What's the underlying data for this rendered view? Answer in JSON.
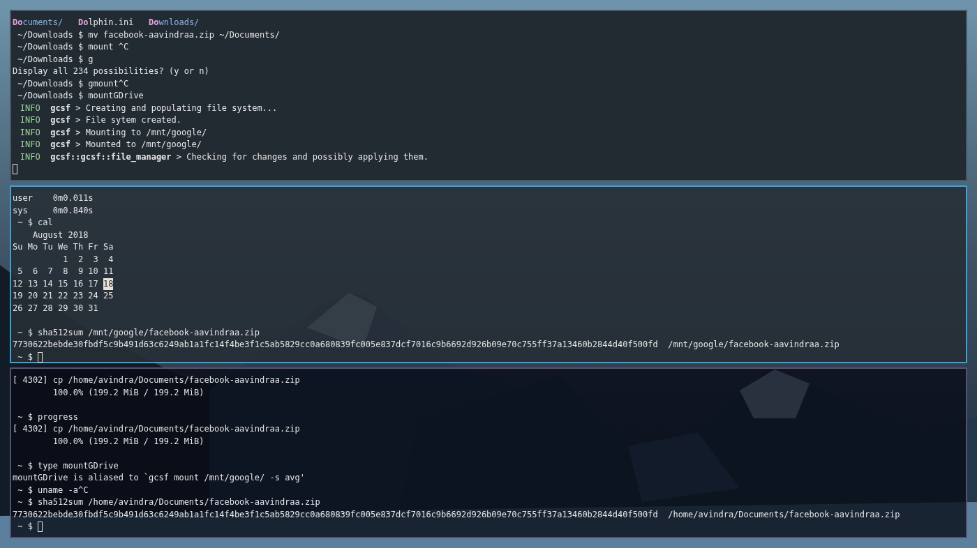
{
  "panes": [
    {
      "selected": false,
      "lines": [
        {
          "kind": "ls",
          "entries": [
            {
              "match": "Do",
              "rest": "cuments/",
              "kind": "directory"
            },
            {
              "match": "Do",
              "rest": "lphin.ini",
              "kind": "file"
            },
            {
              "match": "Do",
              "rest": "wnloads/",
              "kind": "directory"
            }
          ]
        },
        {
          "kind": "prompt",
          "text": "~/Downloads $ mv facebook-aavindraa.zip ~/Documents/"
        },
        {
          "kind": "prompt",
          "text": "~/Downloads $ mount ^C"
        },
        {
          "kind": "prompt",
          "text": "~/Downloads $ g"
        },
        {
          "kind": "text",
          "text": "Display all 234 possibilities? (y or n)"
        },
        {
          "kind": "prompt",
          "text": "~/Downloads $ gmount^C"
        },
        {
          "kind": "prompt",
          "text": "~/Downloads $ mountGDrive"
        },
        {
          "kind": "log",
          "level": "INFO",
          "source": "gcsf",
          "message": "> Creating and populating file system..."
        },
        {
          "kind": "log",
          "level": "INFO",
          "source": "gcsf",
          "message": "> File sytem created."
        },
        {
          "kind": "log",
          "level": "INFO",
          "source": "gcsf",
          "message": "> Mounting to /mnt/google/"
        },
        {
          "kind": "log",
          "level": "INFO",
          "source": "gcsf",
          "message": "> Mounted to /mnt/google/"
        },
        {
          "kind": "log",
          "level": "INFO",
          "source": "gcsf::gcsf::file_manager",
          "message": "> Checking for changes and possibly applying them."
        },
        {
          "kind": "cursor"
        }
      ]
    },
    {
      "selected": true,
      "lines": [
        {
          "kind": "text",
          "text": "user    0m0.011s"
        },
        {
          "kind": "text",
          "text": "sys     0m0.840s"
        },
        {
          "kind": "prompt",
          "text": "~ $ cal"
        },
        {
          "kind": "text",
          "text": "    August 2018"
        },
        {
          "kind": "text",
          "text": "Su Mo Tu We Th Fr Sa"
        },
        {
          "kind": "text",
          "text": "          1  2  3  4"
        },
        {
          "kind": "week",
          "days": [
            {
              "day": "5",
              "today": false
            },
            {
              "day": "6",
              "today": false
            },
            {
              "day": "7",
              "today": false
            },
            {
              "day": "8",
              "today": false
            },
            {
              "day": "9",
              "today": false
            },
            {
              "day": "10",
              "today": false
            },
            {
              "day": "11",
              "today": false
            }
          ]
        },
        {
          "kind": "week",
          "days": [
            {
              "day": "12",
              "today": false
            },
            {
              "day": "13",
              "today": false
            },
            {
              "day": "14",
              "today": false
            },
            {
              "day": "15",
              "today": false
            },
            {
              "day": "16",
              "today": false
            },
            {
              "day": "17",
              "today": false
            },
            {
              "day": "18",
              "today": true
            }
          ]
        },
        {
          "kind": "week",
          "days": [
            {
              "day": "19",
              "today": false
            },
            {
              "day": "20",
              "today": false
            },
            {
              "day": "21",
              "today": false
            },
            {
              "day": "22",
              "today": false
            },
            {
              "day": "23",
              "today": false
            },
            {
              "day": "24",
              "today": false
            },
            {
              "day": "25",
              "today": false
            }
          ]
        },
        {
          "kind": "week",
          "days": [
            {
              "day": "26",
              "today": false
            },
            {
              "day": "27",
              "today": false
            },
            {
              "day": "28",
              "today": false
            },
            {
              "day": "29",
              "today": false
            },
            {
              "day": "30",
              "today": false
            },
            {
              "day": "31",
              "today": false
            }
          ]
        },
        {
          "kind": "blank"
        },
        {
          "kind": "prompt",
          "text": "~ $ sha512sum /mnt/google/facebook-aavindraa.zip"
        },
        {
          "kind": "text",
          "text": "7730622bebde30fbdf5c9b491d63c6249ab1a1fc14f4be3f1c5ab5829cc0a680839fc005e837dcf7016c9b6692d926b09e70c755ff37a13460b2844d40f500fd  /mnt/google/facebook-aavindraa.zip"
        },
        {
          "kind": "prompt",
          "text": "~ $",
          "cursor": true
        }
      ]
    },
    {
      "selected": false,
      "lines": [
        {
          "kind": "text",
          "text": "[ 4302] cp /home/avindra/Documents/facebook-aavindraa.zip"
        },
        {
          "kind": "text",
          "text": "        100.0% (199.2 MiB / 199.2 MiB)"
        },
        {
          "kind": "blank"
        },
        {
          "kind": "prompt",
          "text": "~ $ progress"
        },
        {
          "kind": "text",
          "text": "[ 4302] cp /home/avindra/Documents/facebook-aavindraa.zip"
        },
        {
          "kind": "text",
          "text": "        100.0% (199.2 MiB / 199.2 MiB)"
        },
        {
          "kind": "blank"
        },
        {
          "kind": "prompt",
          "text": "~ $ type mountGDrive"
        },
        {
          "kind": "text",
          "text": "mountGDrive is aliased to `gcsf mount /mnt/google/ -s avg'"
        },
        {
          "kind": "prompt",
          "text": "~ $ uname -a^C"
        },
        {
          "kind": "prompt",
          "text": "~ $ sha512sum /home/avindra/Documents/facebook-aavindraa.zip"
        },
        {
          "kind": "text",
          "text": "7730622bebde30fbdf5c9b491d63c6249ab1a1fc14f4be3f1c5ab5829cc0a680839fc005e837dcf7016c9b6692d926b09e70c755ff37a13460b2844d40f500fd  /home/avindra/Documents/facebook-aavindraa.zip"
        },
        {
          "kind": "prompt",
          "text": "~ $",
          "cursor": true
        }
      ]
    }
  ]
}
